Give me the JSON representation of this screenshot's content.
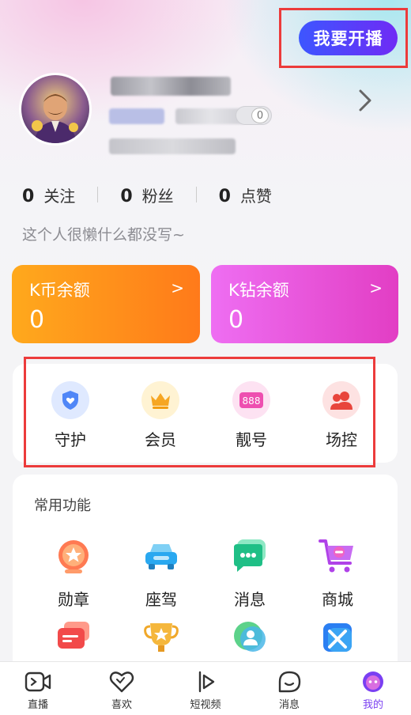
{
  "header": {
    "live_button": "我要开播"
  },
  "stats": [
    {
      "value": "0",
      "label": "关注"
    },
    {
      "value": "0",
      "label": "粉丝"
    },
    {
      "value": "0",
      "label": "点赞"
    }
  ],
  "bio": "这个人很懒什么都没写~",
  "wallet": {
    "coin": {
      "title": "K币余额",
      "value": "0",
      "arrow": ">"
    },
    "diamond": {
      "title": "K钻余额",
      "value": "0",
      "arrow": ">"
    }
  },
  "quick_actions": [
    {
      "label": "守护",
      "icon": "shield-heart-icon"
    },
    {
      "label": "会员",
      "icon": "crown-icon"
    },
    {
      "label": "靓号",
      "icon": "number-888-icon"
    },
    {
      "label": "场控",
      "icon": "users-icon"
    }
  ],
  "functions": {
    "title": "常用功能",
    "items": [
      {
        "label": "勋章",
        "icon": "medal-icon"
      },
      {
        "label": "座驾",
        "icon": "car-icon"
      },
      {
        "label": "消息",
        "icon": "chat-icon"
      },
      {
        "label": "商城",
        "icon": "cart-icon"
      },
      {
        "label": "",
        "icon": "cards-icon"
      },
      {
        "label": "",
        "icon": "trophy-icon"
      },
      {
        "label": "",
        "icon": "contact-icon"
      },
      {
        "label": "",
        "icon": "swords-icon"
      }
    ]
  },
  "tabs": [
    {
      "label": "直播",
      "icon": "live-camera-icon"
    },
    {
      "label": "喜欢",
      "icon": "heart-icon"
    },
    {
      "label": "短视频",
      "icon": "short-video-icon"
    },
    {
      "label": "消息",
      "icon": "message-icon"
    },
    {
      "label": "我的",
      "icon": "profile-face-icon",
      "active": true
    }
  ],
  "colors": {
    "accent": "#7a3ff2",
    "coin_gradient": [
      "#ffa91c",
      "#ff7a1a"
    ],
    "diamond_gradient": [
      "#ee6ef2",
      "#e23ec4"
    ],
    "highlight_border": "#ec3b3b"
  }
}
